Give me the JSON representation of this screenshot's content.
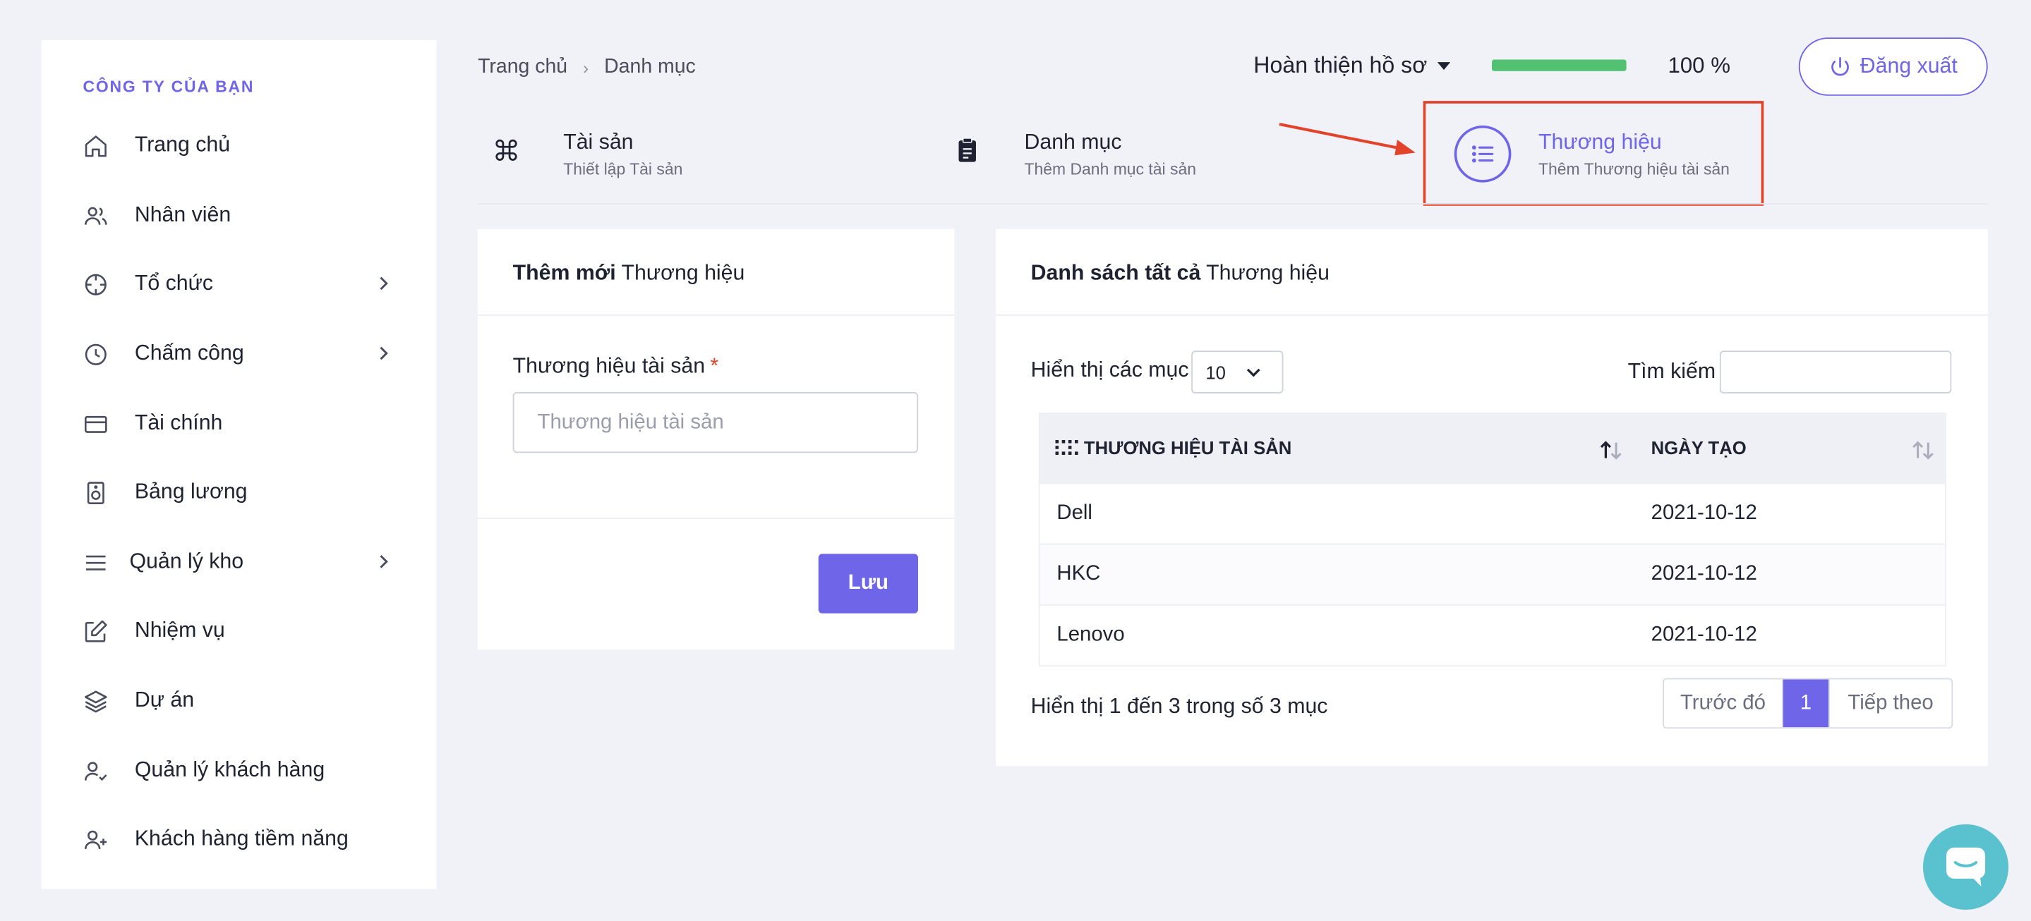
{
  "sidebar": {
    "company": "CÔNG TY CỦA BẠN",
    "items": [
      {
        "label": "Trang chủ"
      },
      {
        "label": "Nhân viên"
      },
      {
        "label": "Tổ chức"
      },
      {
        "label": "Chấm công"
      },
      {
        "label": "Tài chính"
      },
      {
        "label": "Bảng lương"
      },
      {
        "label": "Quản lý kho"
      },
      {
        "label": "Nhiệm vụ"
      },
      {
        "label": "Dự án"
      },
      {
        "label": "Quản lý khách hàng"
      },
      {
        "label": "Khách hàng tiềm năng"
      }
    ]
  },
  "breadcrumb": {
    "home": "Trang chủ",
    "sep": "›",
    "current": "Danh mục"
  },
  "header": {
    "profile_label": "Hoàn thiện hồ sơ",
    "progress_value": 100,
    "progress_text": "100 %",
    "logout_label": "Đăng xuất"
  },
  "steps": [
    {
      "title": "Tài sản",
      "subtitle": "Thiết lập Tài sản"
    },
    {
      "title": "Danh mục",
      "subtitle": "Thêm Danh mục tài sản"
    },
    {
      "title": "Thương hiệu",
      "subtitle": "Thêm Thương hiệu tài sản"
    }
  ],
  "form_card": {
    "title_bold": "Thêm mới",
    "title_rest": " Thương hiệu",
    "field_label": "Thương hiệu tài sản",
    "required_mark": "*",
    "field_placeholder": "Thương hiệu tài sản",
    "field_value": "",
    "save_label": "Lưu"
  },
  "list_card": {
    "title_bold": "Danh sách tất cả",
    "title_rest": " Thương hiệu",
    "show_label": "Hiển thị các mục",
    "page_length": "10",
    "search_label": "Tìm kiếm",
    "search_value": "",
    "columns": [
      "THƯƠNG HIỆU TÀI SẢN",
      "NGÀY TẠO"
    ],
    "rows": [
      {
        "brand": "Dell",
        "created": "2021-10-12"
      },
      {
        "brand": "HKC",
        "created": "2021-10-12"
      },
      {
        "brand": "Lenovo",
        "created": "2021-10-12"
      }
    ],
    "info": "Hiển thị 1 đến 3 trong số 3 mục",
    "pagination": {
      "prev": "Trước đó",
      "current": "1",
      "next": "Tiếp theo"
    }
  },
  "colors": {
    "accent": "#6f65e8",
    "progress": "#52c272",
    "highlight": "#e2432a",
    "chat": "#5ac2cf"
  }
}
